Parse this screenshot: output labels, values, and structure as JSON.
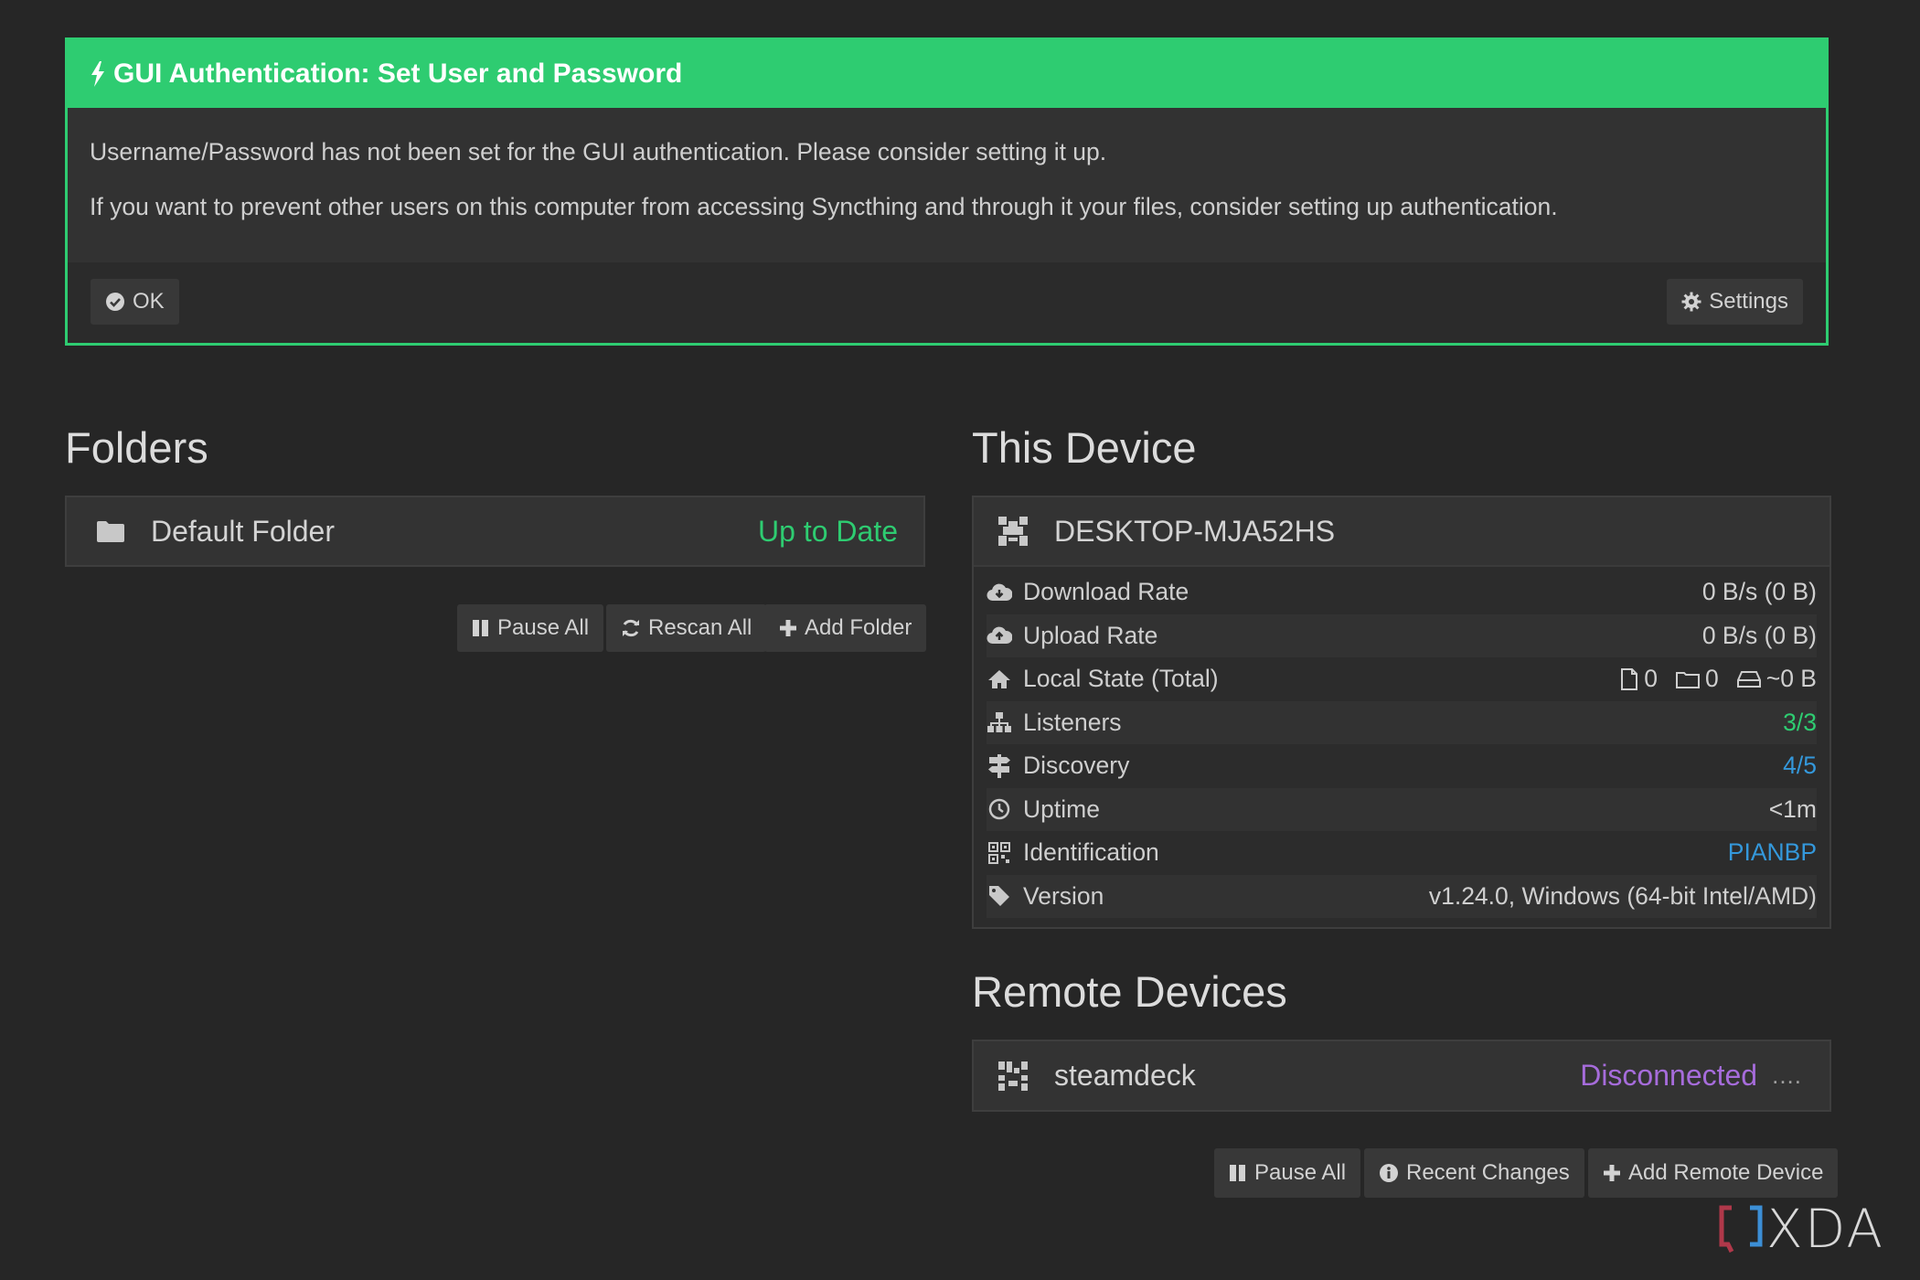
{
  "alert": {
    "title": "GUI Authentication: Set User and Password",
    "message_1": "Username/Password has not been set for the GUI authentication. Please consider setting it up.",
    "message_2": "If you want to prevent other users on this computer from accessing Syncthing and through it your files, consider setting up authentication.",
    "ok_label": "OK",
    "settings_label": "Settings",
    "accent_color": "#2ecc71"
  },
  "folders": {
    "title": "Folders",
    "items": [
      {
        "name": "Default Folder",
        "status": "Up to Date",
        "icon": "folder-icon"
      }
    ],
    "buttons": {
      "pause_all": "Pause All",
      "rescan_all": "Rescan All",
      "add_folder": "Add Folder"
    }
  },
  "this_device": {
    "title": "This Device",
    "name": "DESKTOP-MJA52HS",
    "stats": [
      {
        "label": "Download Rate",
        "value": "0 B/s (0 B)",
        "icon": "cloud-download-icon"
      },
      {
        "label": "Upload Rate",
        "value": "0 B/s (0 B)",
        "icon": "cloud-upload-icon"
      },
      {
        "label": "Local State (Total)",
        "files": "0",
        "dirs": "0",
        "size": "~0 B",
        "icon": "home-icon"
      },
      {
        "label": "Listeners",
        "value": "3/3",
        "icon": "sitemap-icon"
      },
      {
        "label": "Discovery",
        "value": "4/5",
        "icon": "signpost-icon"
      },
      {
        "label": "Uptime",
        "value": "<1m",
        "icon": "clock-icon"
      },
      {
        "label": "Identification",
        "value": "PIANBP",
        "icon": "qrcode-icon"
      },
      {
        "label": "Version",
        "value": "v1.24.0, Windows (64-bit Intel/AMD)",
        "icon": "tag-icon"
      }
    ]
  },
  "remote_devices": {
    "title": "Remote Devices",
    "items": [
      {
        "name": "steamdeck",
        "status": "Disconnected",
        "extra": "...."
      }
    ],
    "buttons": {
      "pause_all": "Pause All",
      "recent_changes": "Recent Changes",
      "add_remote_device": "Add Remote Device"
    }
  },
  "watermark": {
    "text": "XDA"
  },
  "colors": {
    "up_to_date": "#2ecc71",
    "disconnected": "#a66cdb",
    "link_blue": "#3498db",
    "background": "#262626"
  }
}
